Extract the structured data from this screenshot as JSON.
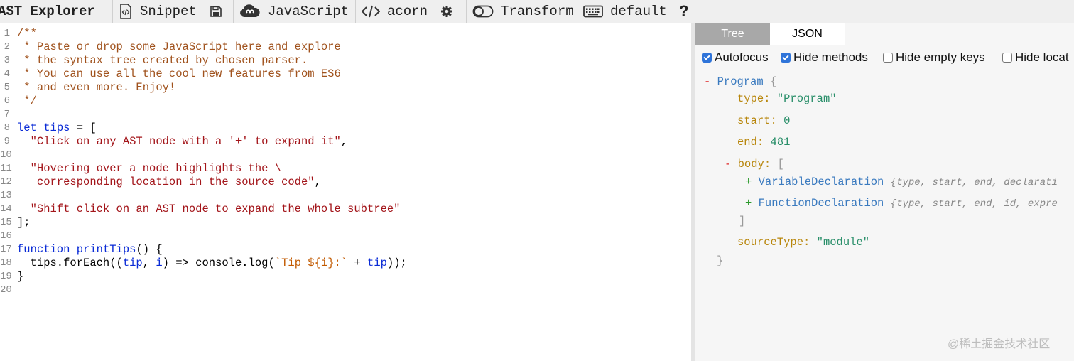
{
  "toolbar": {
    "title": "AST Explorer",
    "snippet": "Snippet",
    "language": "JavaScript",
    "parser": "acorn",
    "transform": "Transform",
    "keymap": "default",
    "help": "?"
  },
  "editor": {
    "lines": [
      {
        "n": "1"
      },
      {
        "n": "2"
      },
      {
        "n": "3"
      },
      {
        "n": "4"
      },
      {
        "n": "5"
      },
      {
        "n": "6"
      },
      {
        "n": "7"
      },
      {
        "n": "8"
      },
      {
        "n": "9"
      },
      {
        "n": "10"
      },
      {
        "n": "11"
      },
      {
        "n": "12"
      },
      {
        "n": "13"
      },
      {
        "n": "14"
      },
      {
        "n": "15"
      },
      {
        "n": "16"
      },
      {
        "n": "17"
      },
      {
        "n": "18"
      },
      {
        "n": "19"
      },
      {
        "n": "20"
      }
    ],
    "code": {
      "l1": "/**",
      "l2": " * Paste or drop some JavaScript here and explore",
      "l3": " * the syntax tree created by chosen parser.",
      "l4": " * You can use all the cool new features from ES6",
      "l5": " * and even more. Enjoy!",
      "l6": " */",
      "l8_kw": "let",
      "l8_var": "tips",
      "l8_rest": " = [",
      "l9": "  \"Click on any AST node with a '+' to expand it\"",
      "l9_comma": ",",
      "l11": "  \"Hovering over a node highlights the \\",
      "l12": "   corresponding location in the source code\"",
      "l12_comma": ",",
      "l14": "  \"Shift click on an AST node to expand the whole subtree\"",
      "l15": "];",
      "l17_kw": "function",
      "l17_fn": "printTips",
      "l17_rest": "() {",
      "l18_a": "  tips.forEach((",
      "l18_tip": "tip",
      "l18_b": ", ",
      "l18_i": "i",
      "l18_c": ") => console.log(",
      "l18_tpl": "`Tip ${i}:`",
      "l18_d": " + ",
      "l18_tip2": "tip",
      "l18_e": "));",
      "l19": "}"
    }
  },
  "panel": {
    "tabs": [
      "Tree",
      "JSON"
    ],
    "options": [
      {
        "label": "Autofocus",
        "checked": true
      },
      {
        "label": "Hide methods",
        "checked": true
      },
      {
        "label": "Hide empty keys",
        "checked": false
      },
      {
        "label": "Hide locat",
        "checked": false
      }
    ],
    "tree": {
      "root_toggle": "-",
      "root": "Program",
      "open_brace": "{",
      "type_key": "type:",
      "type_val": "\"Program\"",
      "start_key": "start:",
      "start_val": "0",
      "end_key": "end:",
      "end_val": "481",
      "body_toggle": "-",
      "body_key": "body:",
      "open_bracket": "[",
      "child1_toggle": "+",
      "child1": "VariableDeclaration",
      "child1_summary": "{type, start, end, declarati",
      "child2_toggle": "+",
      "child2": "FunctionDeclaration",
      "child2_summary": "{type, start, end, id, expre",
      "close_bracket": "]",
      "st_key": "sourceType:",
      "st_val": "\"module\"",
      "close_brace": "}"
    }
  },
  "watermark": "@稀土掘金技术社区",
  "colors": {
    "accent": "#2f74d9",
    "comment": "#a0521d",
    "keyword": "#0a2bd6",
    "string": "#a3151a"
  }
}
